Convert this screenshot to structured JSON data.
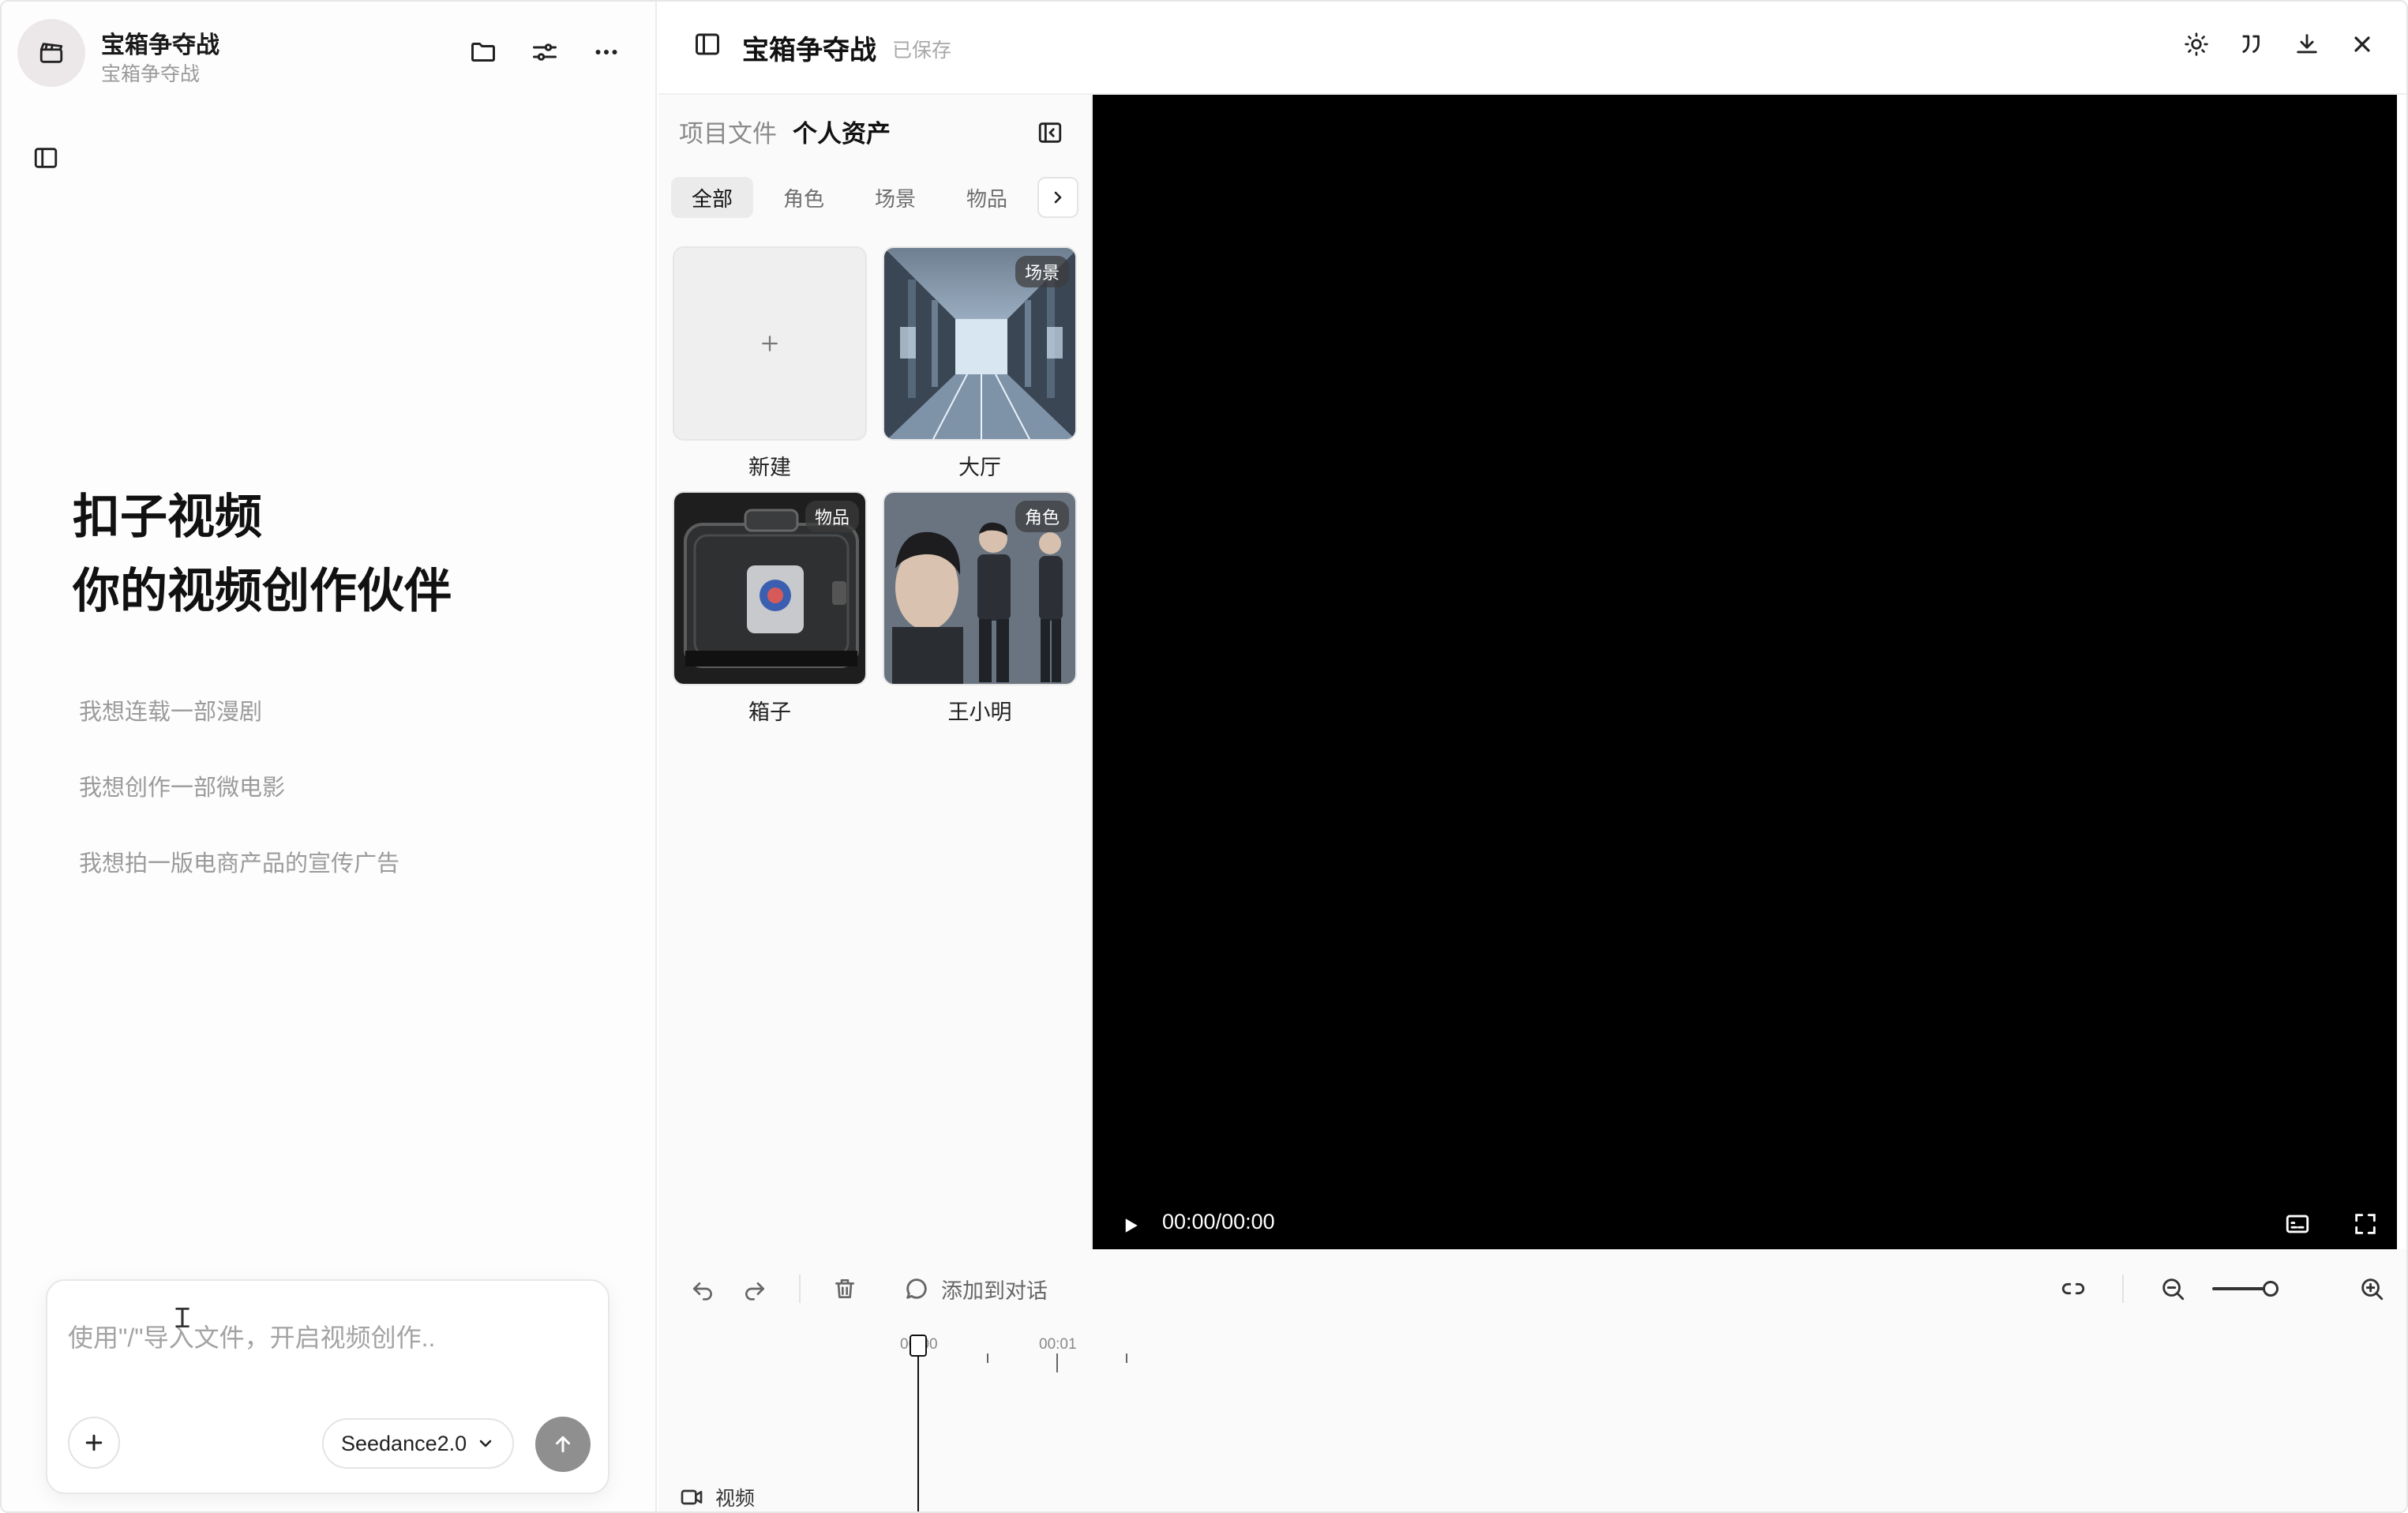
{
  "project": {
    "name": "宝箱争夺战",
    "subtitle": "宝箱争夺战"
  },
  "hero": {
    "line1": "扣子视频",
    "line2": "你的视频创作伙伴"
  },
  "suggestions": [
    "我想连载一部漫剧",
    "我想创作一部微电影",
    "我想拍一版电商产品的宣传广告"
  ],
  "composer": {
    "placeholder": "使用\"/\"导入文件，开启视频创作..",
    "model": "Seedance2.0"
  },
  "topbar": {
    "title": "宝箱争夺战",
    "status": "已保存"
  },
  "assets": {
    "tabs": [
      "项目文件",
      "个人资产"
    ],
    "filters": [
      "全部",
      "角色",
      "场景",
      "物品"
    ],
    "items": [
      {
        "label": "新建",
        "badge": ""
      },
      {
        "label": "大厅",
        "badge": "场景"
      },
      {
        "label": "箱子",
        "badge": "物品"
      },
      {
        "label": "王小明",
        "badge": "角色"
      }
    ]
  },
  "player": {
    "time": "00:00/00:00"
  },
  "timeline": {
    "add_to_chat": "添加到对话",
    "ruler": [
      "00:00",
      "00:01"
    ],
    "track": "视频"
  },
  "colors": {
    "accent_dark": "#111111",
    "send_button": "#8f8f8f",
    "video_bg": "#000000"
  }
}
